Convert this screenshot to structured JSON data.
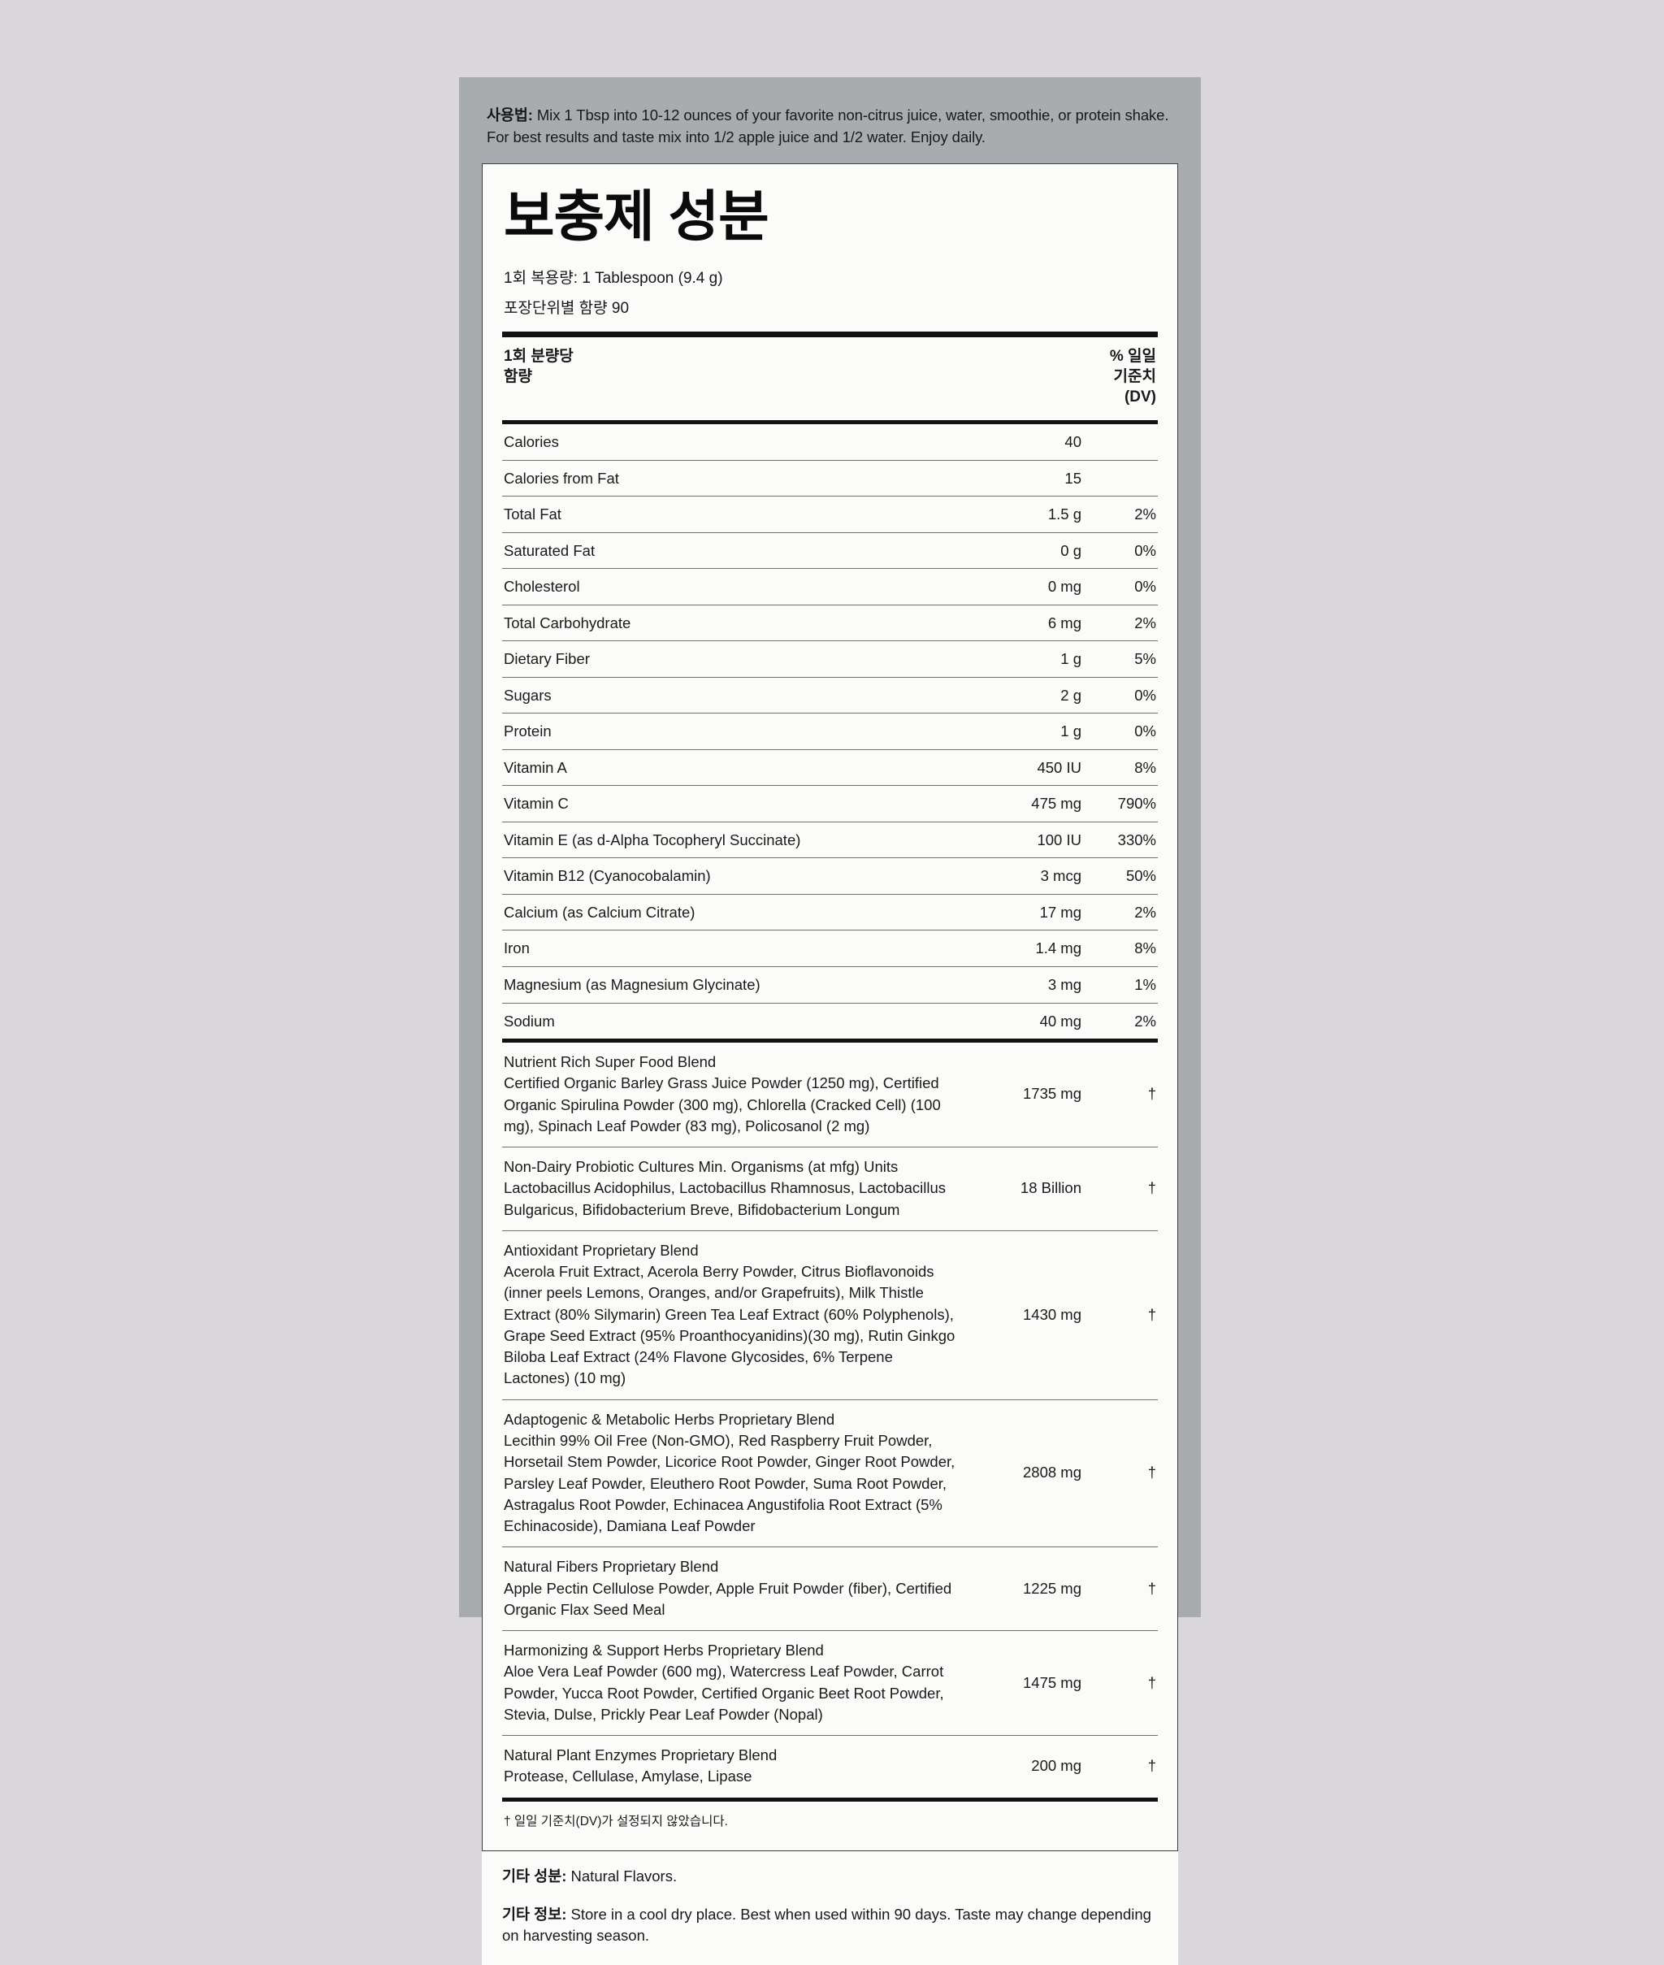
{
  "directions": {
    "label": "사용법:",
    "text": " Mix 1 Tbsp into 10-12 ounces of your favorite non-citrus juice, water, smoothie, or protein shake. For best results and taste mix into 1/2 apple juice and 1/2 water. Enjoy daily."
  },
  "panel": {
    "title": "보충제 성분",
    "serving_size": "1회 복용량: 1 Tablespoon (9.4 g)",
    "servings_per_container": "포장단위별 함량 90",
    "column_header_left_line1": "1회 분량당",
    "column_header_left_line2": "함량",
    "column_header_right_line1": "% 일일",
    "column_header_right_line2": "기준치",
    "column_header_right_line3": "(DV)",
    "footnote": "† 일일 기준치(DV)가 설정되지 않았습니다."
  },
  "nutrients": [
    {
      "name": "Calories",
      "indent": false,
      "amount": "40",
      "dv": ""
    },
    {
      "name": "Calories from Fat",
      "indent": true,
      "amount": "15",
      "dv": ""
    },
    {
      "name": "Total Fat",
      "indent": false,
      "amount": "1.5 g",
      "dv": "2%"
    },
    {
      "name": "Saturated Fat",
      "indent": true,
      "amount": "0 g",
      "dv": "0%"
    },
    {
      "name": "Cholesterol",
      "indent": false,
      "amount": "0 mg",
      "dv": "0%"
    },
    {
      "name": "Total Carbohydrate",
      "indent": false,
      "amount": "6 mg",
      "dv": "2%"
    },
    {
      "name": "Dietary Fiber",
      "indent": false,
      "amount": "1 g",
      "dv": "5%"
    },
    {
      "name": "Sugars",
      "indent": true,
      "amount": "2 g",
      "dv": "0%"
    },
    {
      "name": "Protein",
      "indent": false,
      "amount": "1 g",
      "dv": "0%"
    },
    {
      "name": "Vitamin A",
      "indent": false,
      "amount": "450 IU",
      "dv": "8%"
    },
    {
      "name": "Vitamin C",
      "indent": false,
      "amount": "475 mg",
      "dv": "790%"
    },
    {
      "name": "Vitamin E (as d-Alpha Tocopheryl Succinate)",
      "indent": false,
      "amount": "100 IU",
      "dv": "330%"
    },
    {
      "name": "Vitamin B12 (Cyanocobalamin)",
      "indent": false,
      "amount": "3 mcg",
      "dv": "50%"
    },
    {
      "name": "Calcium (as Calcium Citrate)",
      "indent": false,
      "amount": "17 mg",
      "dv": "2%"
    },
    {
      "name": "Iron",
      "indent": false,
      "amount": "1.4 mg",
      "dv": "8%"
    },
    {
      "name": "Magnesium (as Magnesium Glycinate)",
      "indent": false,
      "amount": "3 mg",
      "dv": "1%"
    },
    {
      "name": "Sodium",
      "indent": false,
      "amount": "40 mg",
      "dv": "2%"
    }
  ],
  "blends": [
    {
      "title": "Nutrient Rich Super Food Blend",
      "ingredients": "Certified Organic Barley Grass Juice Powder (1250 mg), Certified Organic Spirulina Powder (300 mg), Chlorella (Cracked Cell) (100 mg), Spinach Leaf Powder (83 mg), Policosanol (2 mg)",
      "amount": "1735 mg",
      "dv": "†"
    },
    {
      "title": "Non-Dairy Probiotic Cultures Min. Organisms (at mfg) Units",
      "ingredients": "Lactobacillus Acidophilus, Lactobacillus Rhamnosus, Lactobacillus Bulgaricus, Bifidobacterium Breve, Bifidobacterium Longum",
      "amount": "18 Billion",
      "dv": "†"
    },
    {
      "title": "Antioxidant Proprietary Blend",
      "ingredients": "Acerola Fruit Extract, Acerola Berry Powder, Citrus Bioflavonoids (inner peels Lemons, Oranges, and/or Grapefruits), Milk Thistle Extract (80% Silymarin) Green Tea Leaf Extract (60% Polyphenols), Grape Seed Extract (95% Proanthocyanidins)(30 mg), Rutin Ginkgo Biloba Leaf Extract (24% Flavone Glycosides, 6% Terpene Lactones) (10 mg)",
      "amount": "1430 mg",
      "dv": "†"
    },
    {
      "title": "Adaptogenic & Metabolic Herbs Proprietary Blend",
      "ingredients": "Lecithin 99% Oil Free (Non-GMO), Red Raspberry Fruit Powder, Horsetail Stem Powder, Licorice Root Powder, Ginger Root Powder, Parsley Leaf Powder, Eleuthero Root Powder, Suma Root Powder, Astragalus Root Powder, Echinacea Angustifolia Root Extract (5% Echinacoside), Damiana Leaf Powder",
      "amount": "2808 mg",
      "dv": "†"
    },
    {
      "title": "Natural Fibers Proprietary Blend",
      "ingredients": "Apple Pectin Cellulose Powder, Apple Fruit Powder (fiber), Certified Organic Flax Seed Meal",
      "amount": "1225 mg",
      "dv": "†"
    },
    {
      "title": "Harmonizing & Support Herbs Proprietary Blend",
      "ingredients": "Aloe Vera Leaf Powder (600 mg), Watercress Leaf Powder, Carrot Powder, Yucca Root Powder, Certified Organic Beet Root Powder, Stevia, Dulse, Prickly Pear Leaf Powder (Nopal)",
      "amount": "1475 mg",
      "dv": "†"
    },
    {
      "title": "Natural Plant Enzymes Proprietary Blend",
      "ingredients": "Protease, Cellulase, Amylase, Lipase",
      "amount": "200 mg",
      "dv": "†"
    }
  ],
  "notes": [
    {
      "label": "기타 성분:",
      "text": " Natural Flavors."
    },
    {
      "label": "기타 정보:",
      "text": " Store in a cool dry place. Best when used within 90 days. Taste may change depending on harvesting season."
    }
  ]
}
